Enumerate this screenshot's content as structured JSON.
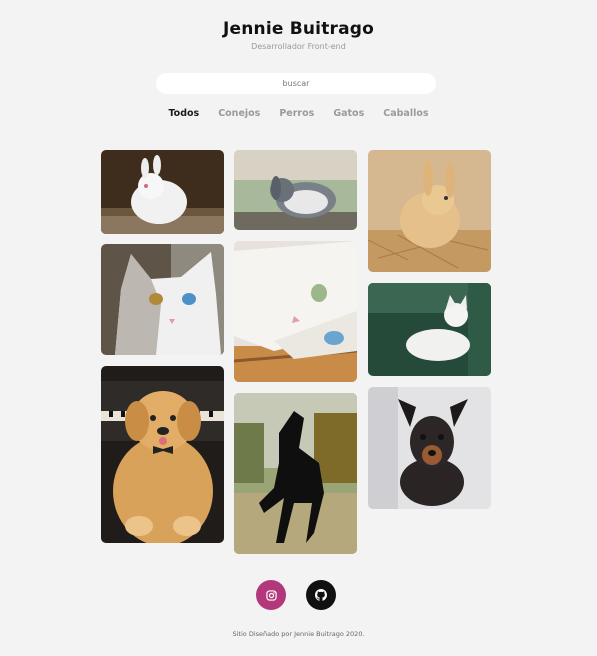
{
  "header": {
    "name": "Jennie Buitrago",
    "subtitle": "Desarrollador Front-end"
  },
  "search": {
    "placeholder": "buscar"
  },
  "filters": [
    {
      "label": "Todos",
      "active": true
    },
    {
      "label": "Conejos",
      "active": false
    },
    {
      "label": "Perros",
      "active": false
    },
    {
      "label": "Gatos",
      "active": false
    },
    {
      "label": "Caballos",
      "active": false
    }
  ],
  "gallery": [
    {
      "alt": "conejo blanco"
    },
    {
      "alt": "gato de ojos de distinto color"
    },
    {
      "alt": "cachorro golden retriever"
    },
    {
      "alt": "conejo gris"
    },
    {
      "alt": "gato blanco acostado"
    },
    {
      "alt": "caballo negro"
    },
    {
      "alt": "conejo dorado"
    },
    {
      "alt": "gato blanco en sillón verde"
    },
    {
      "alt": "perro salchicha negro"
    }
  ],
  "social": {
    "instagram_color": "#b3387b",
    "github_color": "#111111"
  },
  "footer": {
    "text": "Sitio Diseñado por Jennie Buitrago 2020."
  }
}
